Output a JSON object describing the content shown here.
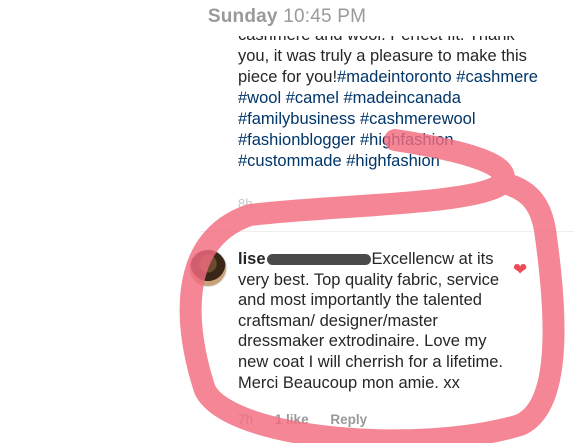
{
  "header": {
    "day": "Sunday",
    "time": "10:45 PM"
  },
  "post_caption": {
    "cut_line": "cashmere and wool. Perfect fit. Thank",
    "text": "you, it was truly a pleasure to make this piece for you!",
    "hashtags": "#madeintoronto #cashmere #wool #camel #madeincanada #familybusiness #cashmerewool #fashionblogger #highfashion #custommade #highfashion",
    "age": "8h"
  },
  "comment": {
    "username": "lise",
    "text": "Excellencw at its very best.  Top quality fabric, service and most importantly the talented craftsman/ designer/master dressmaker extrodinaire.  Love my new coat I will cherrish for a lifetime. Merci Beaucoup mon amie.  xx",
    "age": "7h",
    "likes": "1 like",
    "reply": "Reply",
    "liked": true
  },
  "colors": {
    "hashtag": "#003569",
    "heart": "#ed4956",
    "annotation": "#f26b7f"
  }
}
